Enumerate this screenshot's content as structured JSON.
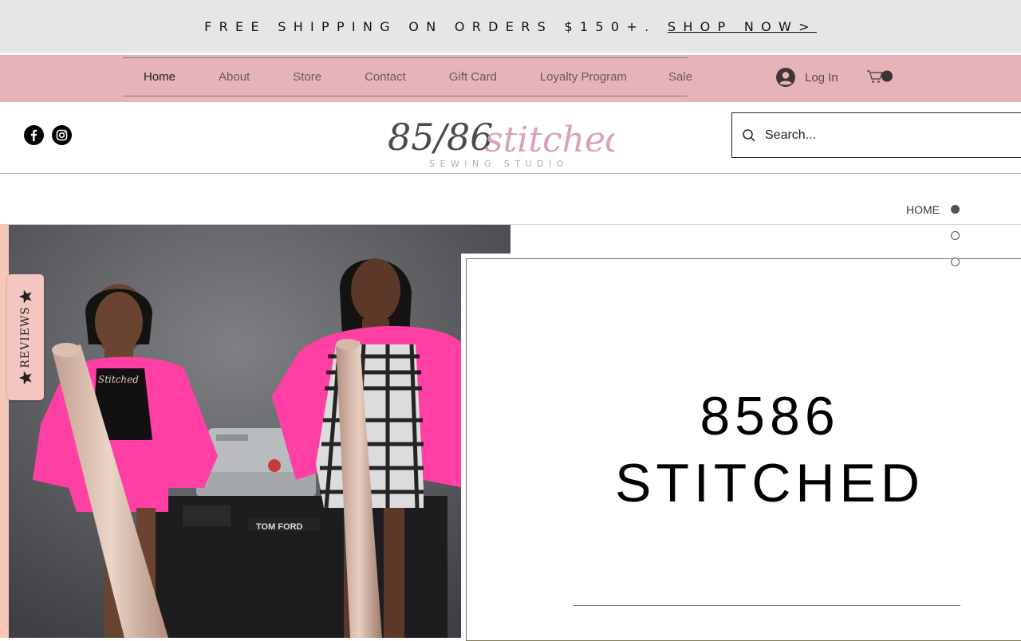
{
  "promo": {
    "text": "FREE SHIPPING ON ORDERS $150+. ",
    "link_label": "SHOP NOW>"
  },
  "nav": {
    "items": [
      {
        "label": "Home"
      },
      {
        "label": "About"
      },
      {
        "label": "Store"
      },
      {
        "label": "Contact"
      },
      {
        "label": "Gift Card"
      },
      {
        "label": "Loyalty Program"
      },
      {
        "label": "Sale"
      }
    ],
    "active": "Home"
  },
  "account": {
    "login_label": "Log In"
  },
  "cart": {
    "icon": "cart-icon",
    "count": ""
  },
  "social": [
    "facebook-icon",
    "instagram-icon"
  ],
  "logo": {
    "numerals": "85/86",
    "script": "stitched",
    "tagline": "SEWING STUDIO"
  },
  "search": {
    "placeholder": "Search..."
  },
  "anchor_menu": {
    "items": [
      {
        "label": "HOME",
        "active": true
      },
      {
        "label": "",
        "active": false
      },
      {
        "label": "",
        "active": false
      }
    ]
  },
  "hero": {
    "title": "8586 STITCHED",
    "photo_shirt_text": "Stitched",
    "photo_book_text": "TOM FORD"
  },
  "reviews": {
    "label": "REVIEWS"
  },
  "colors": {
    "promo_bg": "#e7e6e7",
    "nav_bg": "#e6b4b8",
    "reviews_bg": "#f3c6c2",
    "accent_pink": "#ff3fa4",
    "frame_border": "#857a52"
  }
}
